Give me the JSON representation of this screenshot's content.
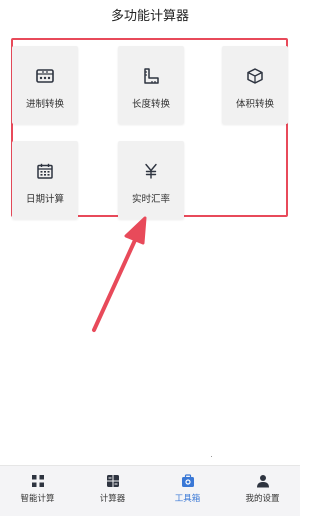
{
  "header": {
    "title": "多功能计算器"
  },
  "tools": [
    {
      "label": "进制转换",
      "icon": "abacus-icon"
    },
    {
      "label": "长度转换",
      "icon": "ruler-icon"
    },
    {
      "label": "体积转换",
      "icon": "cube-icon"
    },
    {
      "label": "日期计算",
      "icon": "calendar-icon"
    },
    {
      "label": "实时汇率",
      "icon": "yen-icon"
    }
  ],
  "tabbar": {
    "items": [
      {
        "label": "智能计算",
        "icon": "grid-icon"
      },
      {
        "label": "计算器",
        "icon": "calculator-icon"
      },
      {
        "label": "工具箱",
        "icon": "toolbox-icon",
        "active": true
      },
      {
        "label": "我的设置",
        "icon": "user-icon"
      }
    ]
  },
  "colors": {
    "highlight": "#e84a5a",
    "active_tab": "#3a78d6",
    "icon_dark": "#2e3440"
  }
}
